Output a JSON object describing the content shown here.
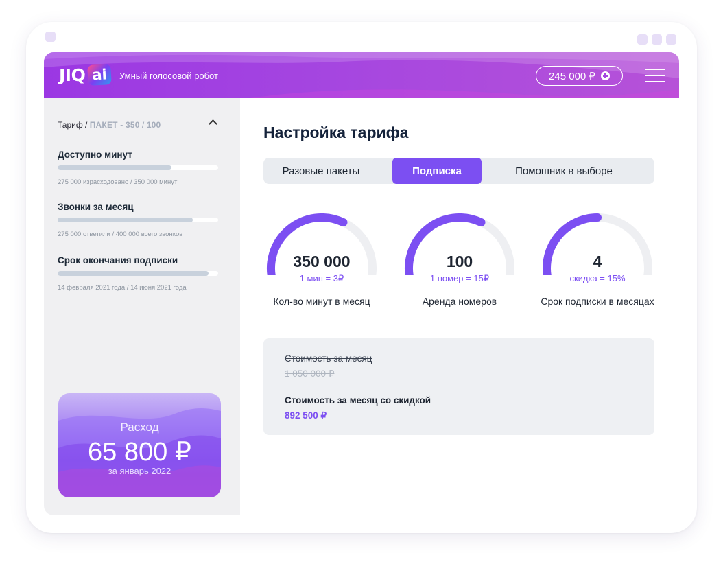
{
  "header": {
    "logo_text": "JIQ",
    "logo_badge": "ai",
    "tagline": "Умный голосовой робот",
    "balance": "245 000 ₽",
    "plus_icon": "plus-circle-icon",
    "menu_icon": "hamburger-menu-icon"
  },
  "sidebar": {
    "tariff_prefix": "Тариф /",
    "tariff_package": "ПАКЕТ - 350",
    "tariff_separator": "/",
    "tariff_count": "100",
    "collapse_icon": "chevron-up-icon",
    "stats": [
      {
        "title": "Доступно минут",
        "progress": 0.71,
        "note": "275 000 израсходовано  /  350 000 минут"
      },
      {
        "title": "Звонки за месяц",
        "progress": 0.84,
        "note": "275 000 ответили  /  400 000 всего звонков"
      },
      {
        "title": "Срок окончания подписки",
        "progress": 0.94,
        "note": "14 февраля 2021 года  /  14 июня 2021 года"
      }
    ],
    "spend": {
      "label": "Расход",
      "amount": "65 800 ₽",
      "period": "за январь 2022"
    }
  },
  "main": {
    "title": "Настройка тарифа",
    "tabs": [
      {
        "label": "Разовые пакеты",
        "active": false
      },
      {
        "label": "Подписка",
        "active": true
      },
      {
        "label": "Помошник в выборе",
        "active": false
      }
    ],
    "gauges": [
      {
        "value": "350 000",
        "sub": "1 мин = 3₽",
        "label": "Кол-во минут в месяц",
        "fill": 0.62
      },
      {
        "value": "100",
        "sub": "1 номер = 15₽",
        "label": "Аренда номеров",
        "fill": 0.62
      },
      {
        "value": "4",
        "sub": "скидка = 15%",
        "label": "Срок подписки в месяцах",
        "fill": 0.5
      }
    ],
    "cost": {
      "old_label": "Стоимость за месяц",
      "old_value": "1 050 000 ₽",
      "new_label": "Стоимость за месяц со скидкой",
      "new_value": "892 500 ₽"
    }
  },
  "colors": {
    "accent": "#7c4ff2",
    "header_gradient": [
      "#9b37e3",
      "#b652d8"
    ],
    "track": "#eeeff2"
  }
}
